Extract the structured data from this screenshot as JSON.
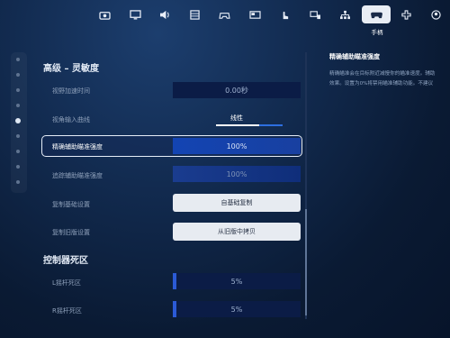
{
  "nav": {
    "tabs": [
      {
        "icon": "camera-icon"
      },
      {
        "icon": "monitor-icon"
      },
      {
        "icon": "speaker-icon"
      },
      {
        "icon": "keyboard-layout-icon"
      },
      {
        "icon": "gamepad-icon"
      },
      {
        "icon": "screen-window-icon"
      },
      {
        "icon": "touch-hand-icon"
      },
      {
        "icon": "controller-settings-icon"
      },
      {
        "icon": "network-icon"
      },
      {
        "icon": "controller-icon",
        "label": "手柄",
        "active": true
      },
      {
        "icon": "dpad-icon"
      },
      {
        "icon": "account-icon"
      }
    ]
  },
  "sections": {
    "sensitivity_title": "高级 – 灵敏度",
    "deadzone_title": "控制器死区"
  },
  "rows": {
    "view_accel_time": {
      "label": "视野加速时间",
      "value": "0.00秒"
    },
    "view_input_curve": {
      "label": "视角输入曲线",
      "value": "线性"
    },
    "precision_aim_assist": {
      "label": "精确辅助瞄准强度",
      "value": "100%"
    },
    "tracking_aim_assist": {
      "label": "追踪辅助瞄准强度",
      "value": "100%"
    },
    "copy_base": {
      "label": "复制基础设置",
      "button": "自基础复制"
    },
    "copy_legacy": {
      "label": "复制旧版设置",
      "button": "从旧版中拷贝"
    },
    "left_stick_deadzone": {
      "label": "L摇杆死区",
      "value": "5%"
    },
    "right_stick_deadzone": {
      "label": "R摇杆死区",
      "value": "5%"
    }
  },
  "description": {
    "title": "精确辅助瞄准强度",
    "lines": [
      "精确瞄准会在目标附近减慢你的瞄准速度。辅助",
      "效果。设置为0%将禁用瞄准辅助功能。不建议"
    ]
  },
  "colors": {
    "accent": "#1344b3",
    "background": "#0a1a33",
    "highlight_border": "#e6edf8"
  }
}
